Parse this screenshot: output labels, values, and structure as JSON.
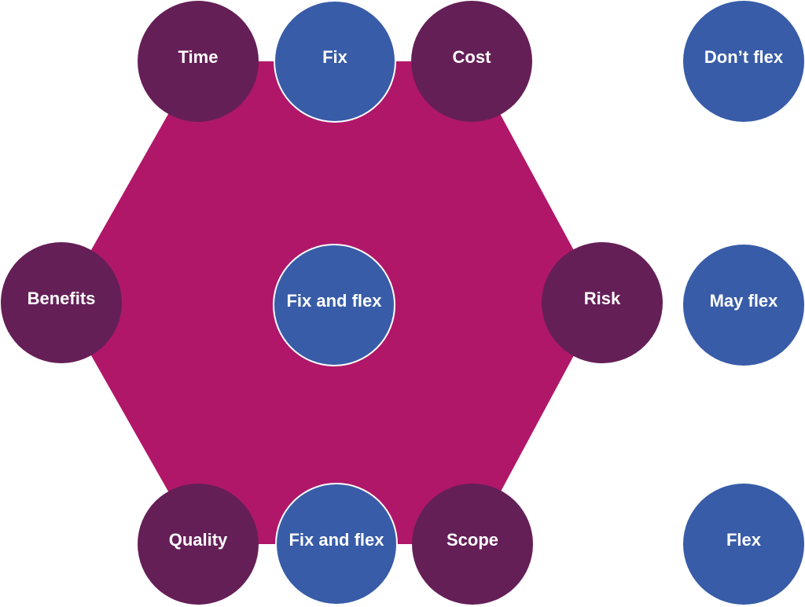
{
  "colors": {
    "hexagon": "#B01769",
    "constraint": "#651F57",
    "flex_level": "#385CA7",
    "outline": "#ffffff"
  },
  "hexagon_nodes": [
    {
      "id": "time",
      "label": "Time"
    },
    {
      "id": "cost",
      "label": "Cost"
    },
    {
      "id": "risk",
      "label": "Risk"
    },
    {
      "id": "scope",
      "label": "Scope"
    },
    {
      "id": "quality",
      "label": "Quality"
    },
    {
      "id": "benefits",
      "label": "Benefits"
    }
  ],
  "edge_nodes": [
    {
      "id": "top",
      "label": "Fix"
    },
    {
      "id": "center",
      "label": "Fix and flex"
    },
    {
      "id": "bottom",
      "label": "Fix and flex"
    }
  ],
  "legend": [
    {
      "label": "Don’t flex"
    },
    {
      "label": "May flex"
    },
    {
      "label": "Flex"
    }
  ]
}
